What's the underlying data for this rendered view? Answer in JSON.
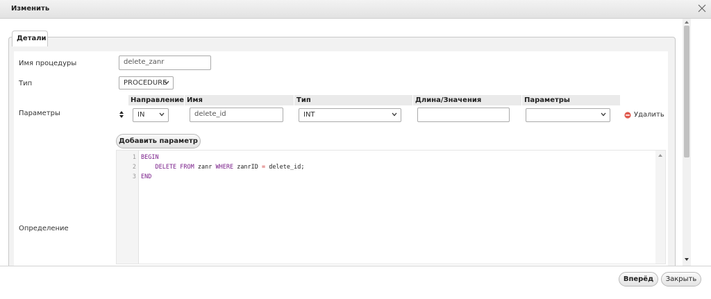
{
  "dialog": {
    "title": "Изменить",
    "tab_label": "Детали"
  },
  "form": {
    "procedure_name_label": "Имя процедуры",
    "procedure_name_value": "delete_zanr",
    "type_label": "Тип",
    "type_value": "PROCEDURE",
    "params_label": "Параметры",
    "definition_label": "Определение",
    "columns": {
      "direction": "Направление",
      "name": "Имя",
      "type": "Тип",
      "length": "Длина/Значения",
      "options": "Параметры"
    },
    "param_row": {
      "direction": "IN",
      "name": "delete_id",
      "type": "INT",
      "length": "",
      "options": "",
      "remove_label": "Удалить"
    },
    "add_param_label": "Добавить параметр"
  },
  "editor": {
    "lines": [
      {
        "num": "1",
        "kw1": "BEGIN",
        "text": "",
        "kw2": "",
        "rest": ""
      },
      {
        "num": "2",
        "kw1": "    DELETE FROM",
        "text": " zanr ",
        "kw2": "WHERE",
        "rest": " zanrID "
      },
      {
        "num": "3",
        "kw1": "END",
        "text": "",
        "kw2": "",
        "rest": ""
      }
    ],
    "line2_op": "=",
    "line2_tail": " delete_id;"
  },
  "footer": {
    "forward_label": "Вперёд",
    "close_label": "Закрыть"
  },
  "colors": {
    "keyword": "#7a1f8a",
    "operator": "#cc3333",
    "remove_icon": "#e05a4e"
  }
}
